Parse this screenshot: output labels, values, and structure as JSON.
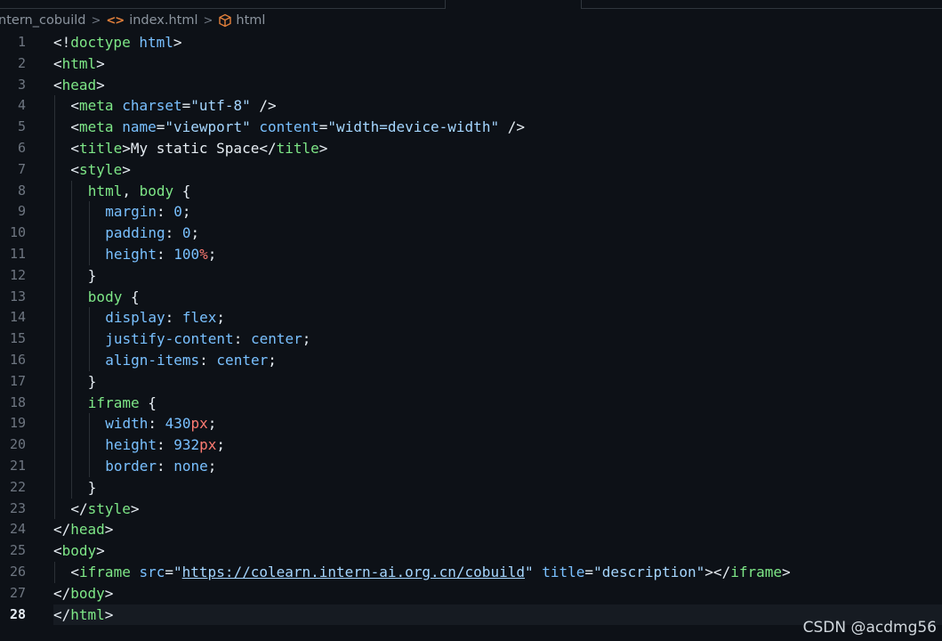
{
  "breadcrumb": {
    "folder": "intern_cobuild",
    "file": "index.html",
    "symbol": "html",
    "sep": ">",
    "file_icon": "code-icon",
    "symbol_icon": "cube-icon",
    "file_icon_glyph": "<>"
  },
  "editor": {
    "active_line": 28,
    "lines": [
      {
        "n": "1",
        "indent": 0,
        "tokens": [
          [
            "punc",
            "<!"
          ],
          [
            "tag",
            "doctype"
          ],
          [
            "punc",
            " "
          ],
          [
            "attr",
            "html"
          ],
          [
            "punc",
            ">"
          ]
        ]
      },
      {
        "n": "2",
        "indent": 0,
        "tokens": [
          [
            "punc",
            "<"
          ],
          [
            "tag",
            "html"
          ],
          [
            "punc",
            ">"
          ]
        ]
      },
      {
        "n": "3",
        "indent": 0,
        "tokens": [
          [
            "punc",
            "<"
          ],
          [
            "tag",
            "head"
          ],
          [
            "punc",
            ">"
          ]
        ]
      },
      {
        "n": "4",
        "indent": 1,
        "tokens": [
          [
            "punc",
            "<"
          ],
          [
            "tag",
            "meta"
          ],
          [
            "punc",
            " "
          ],
          [
            "attr",
            "charset"
          ],
          [
            "punc",
            "="
          ],
          [
            "str",
            "\"utf-8\""
          ],
          [
            "punc",
            " />"
          ]
        ]
      },
      {
        "n": "5",
        "indent": 1,
        "tokens": [
          [
            "punc",
            "<"
          ],
          [
            "tag",
            "meta"
          ],
          [
            "punc",
            " "
          ],
          [
            "attr",
            "name"
          ],
          [
            "punc",
            "="
          ],
          [
            "str",
            "\"viewport\""
          ],
          [
            "punc",
            " "
          ],
          [
            "attr",
            "content"
          ],
          [
            "punc",
            "="
          ],
          [
            "str",
            "\"width=device-width\""
          ],
          [
            "punc",
            " />"
          ]
        ]
      },
      {
        "n": "6",
        "indent": 1,
        "tokens": [
          [
            "punc",
            "<"
          ],
          [
            "tag",
            "title"
          ],
          [
            "punc",
            ">My static Space</"
          ],
          [
            "tag",
            "title"
          ],
          [
            "punc",
            ">"
          ]
        ]
      },
      {
        "n": "7",
        "indent": 1,
        "tokens": [
          [
            "punc",
            "<"
          ],
          [
            "tag",
            "style"
          ],
          [
            "punc",
            ">"
          ]
        ]
      },
      {
        "n": "8",
        "indent": 2,
        "tokens": [
          [
            "sel",
            "html"
          ],
          [
            "punc",
            ", "
          ],
          [
            "sel",
            "body"
          ],
          [
            "punc",
            " {"
          ]
        ]
      },
      {
        "n": "9",
        "indent": 3,
        "tokens": [
          [
            "prop",
            "margin"
          ],
          [
            "punc",
            ": "
          ],
          [
            "num",
            "0"
          ],
          [
            "punc",
            ";"
          ]
        ]
      },
      {
        "n": "10",
        "indent": 3,
        "tokens": [
          [
            "prop",
            "padding"
          ],
          [
            "punc",
            ": "
          ],
          [
            "num",
            "0"
          ],
          [
            "punc",
            ";"
          ]
        ]
      },
      {
        "n": "11",
        "indent": 3,
        "tokens": [
          [
            "prop",
            "height"
          ],
          [
            "punc",
            ": "
          ],
          [
            "num",
            "100"
          ],
          [
            "unit",
            "%"
          ],
          [
            "punc",
            ";"
          ]
        ]
      },
      {
        "n": "12",
        "indent": 2,
        "tokens": [
          [
            "punc",
            "}"
          ]
        ]
      },
      {
        "n": "13",
        "indent": 2,
        "tokens": [
          [
            "sel",
            "body"
          ],
          [
            "punc",
            " {"
          ]
        ]
      },
      {
        "n": "14",
        "indent": 3,
        "tokens": [
          [
            "prop",
            "display"
          ],
          [
            "punc",
            ": "
          ],
          [
            "val",
            "flex"
          ],
          [
            "punc",
            ";"
          ]
        ]
      },
      {
        "n": "15",
        "indent": 3,
        "tokens": [
          [
            "prop",
            "justify-content"
          ],
          [
            "punc",
            ": "
          ],
          [
            "val",
            "center"
          ],
          [
            "punc",
            ";"
          ]
        ]
      },
      {
        "n": "16",
        "indent": 3,
        "tokens": [
          [
            "prop",
            "align-items"
          ],
          [
            "punc",
            ": "
          ],
          [
            "val",
            "center"
          ],
          [
            "punc",
            ";"
          ]
        ]
      },
      {
        "n": "17",
        "indent": 2,
        "tokens": [
          [
            "punc",
            "}"
          ]
        ]
      },
      {
        "n": "18",
        "indent": 2,
        "tokens": [
          [
            "sel",
            "iframe"
          ],
          [
            "punc",
            " {"
          ]
        ]
      },
      {
        "n": "19",
        "indent": 3,
        "tokens": [
          [
            "prop",
            "width"
          ],
          [
            "punc",
            ": "
          ],
          [
            "num",
            "430"
          ],
          [
            "unit",
            "px"
          ],
          [
            "punc",
            ";"
          ]
        ]
      },
      {
        "n": "20",
        "indent": 3,
        "tokens": [
          [
            "prop",
            "height"
          ],
          [
            "punc",
            ": "
          ],
          [
            "num",
            "932"
          ],
          [
            "unit",
            "px"
          ],
          [
            "punc",
            ";"
          ]
        ]
      },
      {
        "n": "21",
        "indent": 3,
        "tokens": [
          [
            "prop",
            "border"
          ],
          [
            "punc",
            ": "
          ],
          [
            "val",
            "none"
          ],
          [
            "punc",
            ";"
          ]
        ]
      },
      {
        "n": "22",
        "indent": 2,
        "tokens": [
          [
            "punc",
            "}"
          ]
        ]
      },
      {
        "n": "23",
        "indent": 1,
        "tokens": [
          [
            "punc",
            "</"
          ],
          [
            "tag",
            "style"
          ],
          [
            "punc",
            ">"
          ]
        ]
      },
      {
        "n": "24",
        "indent": 0,
        "tokens": [
          [
            "punc",
            "</"
          ],
          [
            "tag",
            "head"
          ],
          [
            "punc",
            ">"
          ]
        ]
      },
      {
        "n": "25",
        "indent": 0,
        "tokens": [
          [
            "punc",
            "<"
          ],
          [
            "tag",
            "body"
          ],
          [
            "punc",
            ">"
          ]
        ]
      },
      {
        "n": "26",
        "indent": 1,
        "tokens": [
          [
            "punc",
            "<"
          ],
          [
            "tag",
            "iframe"
          ],
          [
            "punc",
            " "
          ],
          [
            "attr",
            "src"
          ],
          [
            "punc",
            "="
          ],
          [
            "str",
            "\""
          ],
          [
            "link",
            "https://colearn.intern-ai.org.cn/cobuild"
          ],
          [
            "str",
            "\""
          ],
          [
            "punc",
            " "
          ],
          [
            "attr",
            "title"
          ],
          [
            "punc",
            "="
          ],
          [
            "str",
            "\"description\""
          ],
          [
            "punc",
            "></"
          ],
          [
            "tag",
            "iframe"
          ],
          [
            "punc",
            ">"
          ]
        ]
      },
      {
        "n": "27",
        "indent": 0,
        "tokens": [
          [
            "punc",
            "</"
          ],
          [
            "tag",
            "body"
          ],
          [
            "punc",
            ">"
          ]
        ]
      },
      {
        "n": "28",
        "indent": 0,
        "tokens": [
          [
            "punc",
            "</"
          ],
          [
            "tag",
            "html"
          ],
          [
            "punc",
            ">"
          ]
        ]
      }
    ]
  },
  "watermark": "CSDN @acdmg56"
}
